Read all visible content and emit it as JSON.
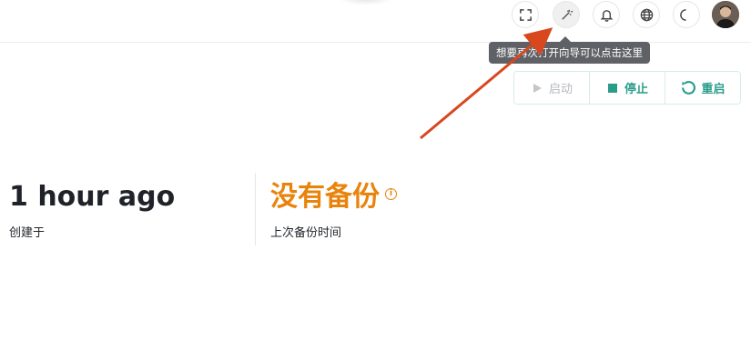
{
  "header": {
    "icons": [
      "fullscreen-icon",
      "magic-wand-icon",
      "bell-icon",
      "globe-icon",
      "moon-icon"
    ],
    "tooltip": "想要再次打开向导可以点击这里"
  },
  "controls": {
    "start_label": "启动",
    "stop_label": "停止",
    "restart_label": "重启",
    "accent_color": "#2a9d8a"
  },
  "stats": {
    "created_value": "1 hour ago",
    "created_label": "创建于",
    "backup_value": "没有备份",
    "backup_label": "上次备份时间",
    "backup_info_glyph": "i",
    "warning_color": "#e8830c"
  }
}
